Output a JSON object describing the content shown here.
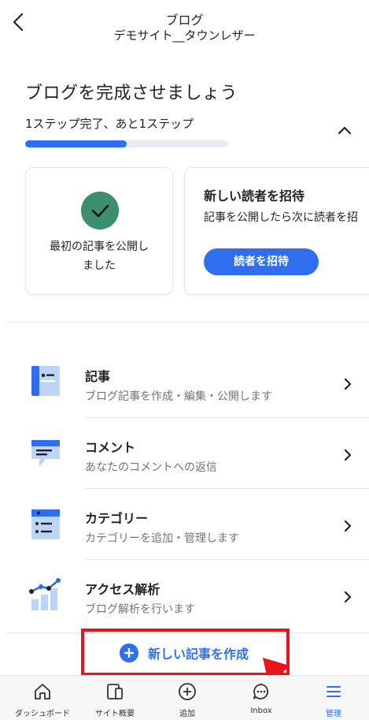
{
  "header": {
    "title": "ブログ",
    "subtitle": "デモサイト__タウンレザー"
  },
  "progress": {
    "title": "ブログを完成させましょう",
    "status": "1ステップ完了、あと1ステップ",
    "completed_fraction": 0.5
  },
  "cards": {
    "done": {
      "text": "最初の記事を公開しました"
    },
    "invite": {
      "title": "新しい読者を招待",
      "description": "記事を公開したら次に読者を招",
      "button": "読者を招待"
    }
  },
  "menu": [
    {
      "title": "記事",
      "description": "ブログ記事を作成・編集・公開します",
      "icon": "posts-icon"
    },
    {
      "title": "コメント",
      "description": "あなたのコメントへの返信",
      "icon": "comments-icon"
    },
    {
      "title": "カテゴリー",
      "description": "カテゴリーを追加・管理します",
      "icon": "categories-icon"
    },
    {
      "title": "アクセス解析",
      "description": "ブログ解析を行います",
      "icon": "analytics-icon"
    }
  ],
  "create": {
    "label": "新しい記事を作成"
  },
  "tabs": [
    {
      "label": "ダッシュボード",
      "icon": "home-icon"
    },
    {
      "label": "サイト概要",
      "icon": "site-overview-icon"
    },
    {
      "label": "追加",
      "icon": "add-icon"
    },
    {
      "label": "Inbox",
      "icon": "inbox-icon"
    },
    {
      "label": "管理",
      "icon": "menu-icon",
      "active": true
    }
  ],
  "colors": {
    "accent": "#2f6fef",
    "success": "#3b8f6a",
    "highlight": "#e8141b",
    "icon_light": "#bcd4f5"
  }
}
